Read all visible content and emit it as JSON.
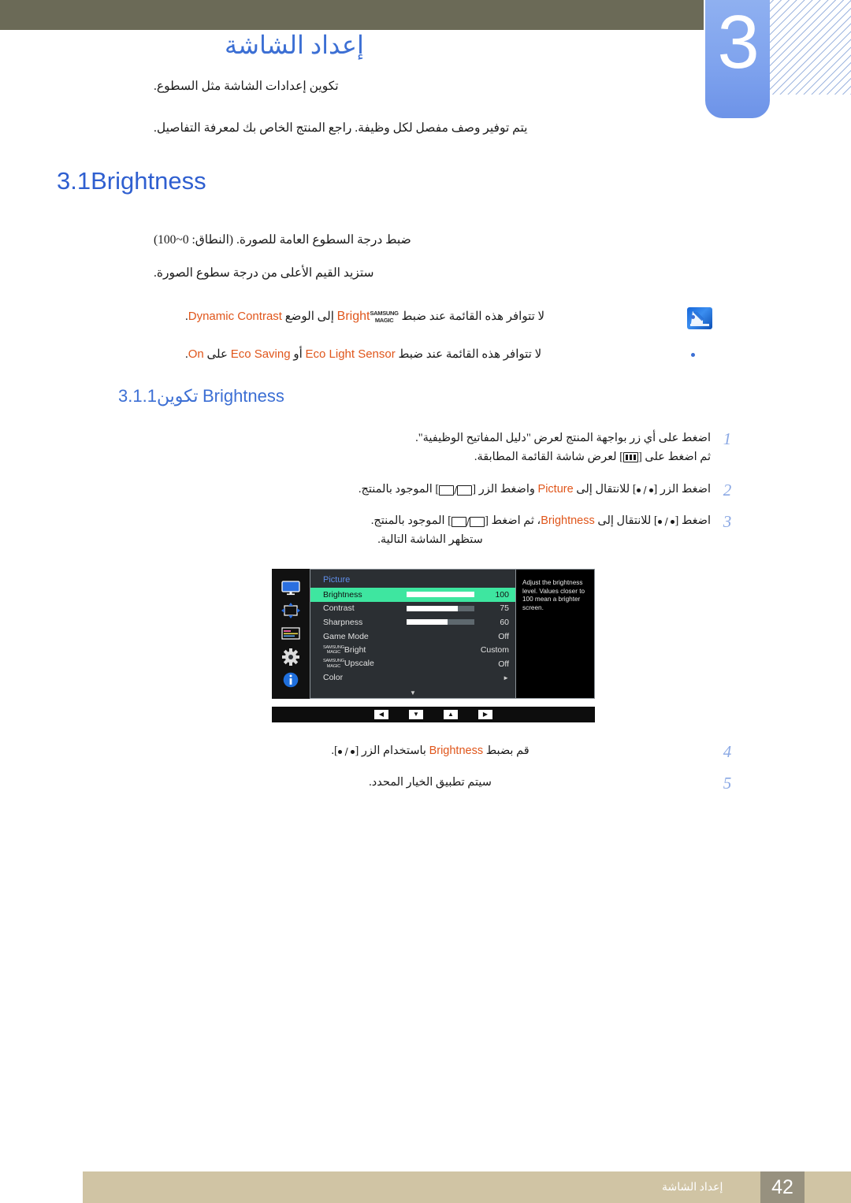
{
  "header": {
    "chapter_number": "3",
    "chapter_title": "إعداد الشاشة",
    "intro_line_1": "تكوين إعدادات الشاشة مثل السطوع.",
    "intro_line_2": "يتم توفير وصف مفصل لكل وظيفة. راجع المنتج الخاص بك لمعرفة التفاصيل."
  },
  "section": {
    "number": "3.1",
    "label": "Brightness",
    "range_text": "ضبط درجة السطوع العامة للصورة. (النطاق: 0~100)",
    "higher_text": "ستزيد القيم الأعلى من درجة سطوع الصورة."
  },
  "notes": {
    "icon_name": "note-icon",
    "bullet_1": {
      "pre": "لا تتوافر هذه القائمة عند ضبط",
      "magic_top": "SAMSUNG",
      "magic_bottom": "MAGIC",
      "magic_word": "Bright",
      "mid": "إلى الوضع",
      "mode": "Dynamic Contrast",
      "post": "."
    },
    "bullet_2": {
      "pre": "لا تتوافر هذه القائمة عند ضبط",
      "opt1": "Eco Light Sensor",
      "conj": "أو",
      "opt2": "Eco Saving",
      "mid": "على",
      "value": "On",
      "post": "."
    }
  },
  "subsection": {
    "number": "3.1.1",
    "label_ar": "تكوين",
    "label_en": "Brightness"
  },
  "steps": [
    {
      "num": "1",
      "line1": "اضغط على أي زر بواجهة المنتج لعرض \"دليل المفاتيح الوظيفية\".",
      "line2_pre": "ثم اضغط على [",
      "line2_post": "] لعرض شاشة القائمة المطابقة."
    },
    {
      "num": "2",
      "pre": "اضغط الزر [",
      "mid1": "] للانتقال إلى",
      "target": "Picture",
      "mid2": "واضغط الزر [",
      "post": "] الموجود بالمنتج."
    },
    {
      "num": "3",
      "pre": "اضغط [",
      "mid1": "] للانتقال إلى",
      "target": "Brightness",
      "mid2": "، ثم اضغط [",
      "post": "] الموجود بالمنتج.",
      "line2": "ستظهر الشاشة التالية."
    },
    {
      "num": "4",
      "pre": "قم بضبط",
      "target": "Brightness",
      "post": "باستخدام الزر [",
      "tail": "]."
    },
    {
      "num": "5",
      "text": "سيتم تطبيق الخيار المحدد."
    }
  ],
  "osd": {
    "menu_title": "Picture",
    "description": "Adjust the brightness level. Values closer to 100 mean a brighter screen.",
    "sidebar_icons": [
      "monitor-icon",
      "position-arrows-icon",
      "osd-lines-icon",
      "gear-icon",
      "info-icon"
    ],
    "accent_color": "#3ee6a0",
    "rows": [
      {
        "label": "Brightness",
        "value": "100",
        "bar": 100,
        "selected": true,
        "type": "slider"
      },
      {
        "label": "Contrast",
        "value": "75",
        "bar": 75,
        "selected": false,
        "type": "slider"
      },
      {
        "label": "Sharpness",
        "value": "60",
        "bar": 60,
        "selected": false,
        "type": "slider"
      },
      {
        "label": "Game Mode",
        "value": "Off",
        "selected": false,
        "type": "value"
      },
      {
        "label": "Bright",
        "value": "Custom",
        "selected": false,
        "type": "magic"
      },
      {
        "label": "Upscale",
        "value": "Off",
        "selected": false,
        "type": "magic"
      },
      {
        "label": "Color",
        "value": "►",
        "selected": false,
        "type": "submenu"
      }
    ],
    "magic_top": "SAMSUNG",
    "magic_bottom": "MAGIC",
    "scroll_down": "▼",
    "nav_buttons": [
      "◀",
      "▼",
      "▲",
      "▶"
    ]
  },
  "footer": {
    "text": "إعداد الشاشة",
    "page_number": "42"
  }
}
